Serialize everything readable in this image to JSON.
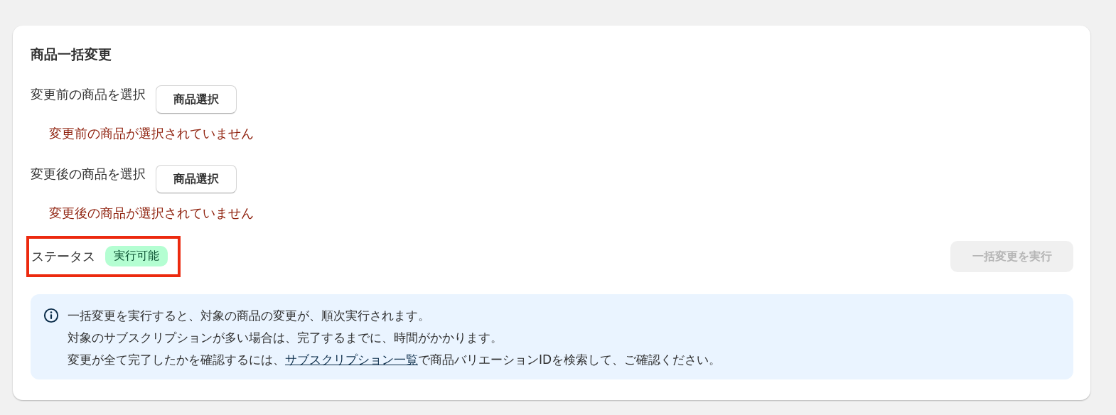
{
  "card": {
    "title": "商品一括変更"
  },
  "selectors": [
    {
      "label": "変更前の商品を選択",
      "button": "商品選択",
      "error": "変更前の商品が選択されていません"
    },
    {
      "label": "変更後の商品を選択",
      "button": "商品選択",
      "error": "変更後の商品が選択されていません"
    }
  ],
  "status": {
    "label": "ステータス",
    "badge": "実行可能",
    "highlighted": true
  },
  "execute_button": {
    "label": "一括変更を実行",
    "disabled": true
  },
  "info": {
    "lines": [
      {
        "segments": [
          {
            "text": "一括変更を実行すると、対象の商品の変更が、順次実行されます。",
            "link": false
          }
        ]
      },
      {
        "segments": [
          {
            "text": "対象のサブスクリプションが多い場合は、完了するまでに、時間がかかります。",
            "link": false
          }
        ]
      },
      {
        "segments": [
          {
            "text": "変更が全て完了したかを確認するには、",
            "link": false
          },
          {
            "text": "サブスクリプション一覧",
            "link": true
          },
          {
            "text": "で商品バリエーションIDを検索して、ご確認ください。",
            "link": false
          }
        ]
      }
    ]
  }
}
